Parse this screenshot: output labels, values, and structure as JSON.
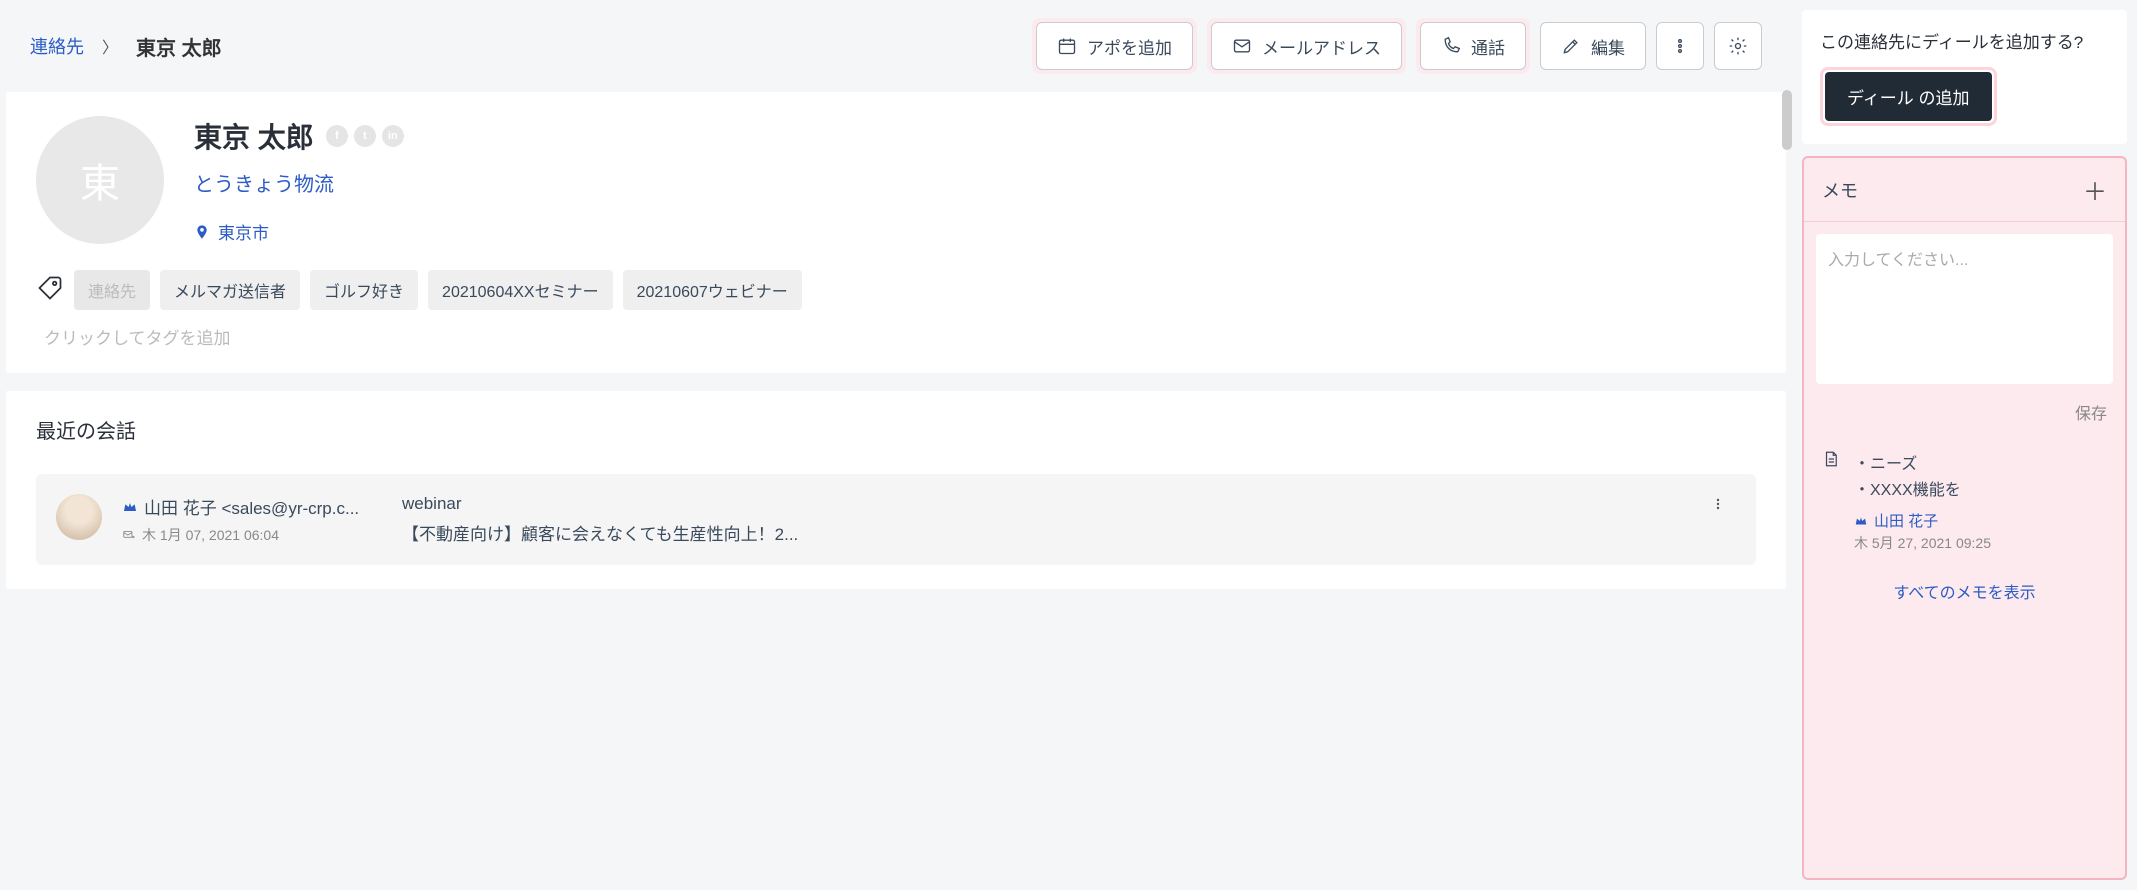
{
  "header": {
    "breadcrumb_link": "連絡先",
    "breadcrumb_current": "東京 太郎",
    "add_appointment": "アポを追加",
    "email_address": "メールアドレス",
    "call": "通話",
    "edit": "編集"
  },
  "profile": {
    "avatar_initial": "東",
    "name": "東京 太郎",
    "company": "とうきょう物流",
    "location": "東京市"
  },
  "tags": {
    "items": [
      {
        "label": "連絡先",
        "muted": true
      },
      {
        "label": "メルマガ送信者"
      },
      {
        "label": "ゴルフ好き"
      },
      {
        "label": "20210604XXセミナー"
      },
      {
        "label": "20210607ウェビナー"
      }
    ],
    "add_placeholder": "クリックしてタグを追加"
  },
  "recent": {
    "title": "最近の会話",
    "item": {
      "from": "山田 花子 <sales@yr-crp.c...",
      "date": "木 1月 07, 2021 06:04",
      "subject": "webinar",
      "snippet": "【不動産向け】顧客に会えなくても生産性向上！2..."
    }
  },
  "sidebar": {
    "deal_prompt": "この連絡先にディールを追加する?",
    "add_deal": "ディール の追加",
    "memo": {
      "title": "メモ",
      "input_placeholder": "入力してください...",
      "save": "保存",
      "item": {
        "line1": "・ニーズ",
        "line2": "・XXXX機能を",
        "author": "山田 花子",
        "date": "木 5月 27, 2021 09:25"
      },
      "show_all": "すべてのメモを表示"
    }
  }
}
